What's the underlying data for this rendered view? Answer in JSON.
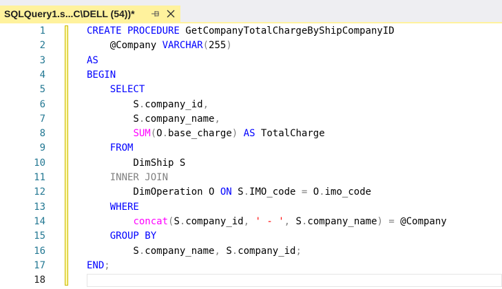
{
  "tab": {
    "title": "SQLQuery1.s...C\\DELL (54))*",
    "pin_icon": "pin-icon",
    "close_icon": "close-icon"
  },
  "colors": {
    "tab_active": "#fff29d",
    "keyword": "#0000ff",
    "operator": "#808080",
    "function": "#ff00ff",
    "string": "#ff0000",
    "line_number": "#237893"
  },
  "editor": {
    "current_line": 18,
    "lines": [
      {
        "num": "1",
        "tokens": [
          [
            "",
            "CREATE PROCEDURE",
            "kw"
          ],
          [
            " GetCompanyTotalChargeByShipCompanyID",
            "txt"
          ]
        ]
      },
      {
        "num": "2",
        "tokens": [
          [
            "    @Company ",
            "txt"
          ],
          [
            "VARCHAR",
            "kw"
          ],
          [
            "(",
            "gray"
          ],
          [
            "255",
            "txt"
          ],
          [
            ")",
            "gray"
          ]
        ]
      },
      {
        "num": "3",
        "tokens": [
          [
            "AS",
            "kw"
          ]
        ]
      },
      {
        "num": "4",
        "tokens": [
          [
            "BEGIN",
            "kw"
          ]
        ]
      },
      {
        "num": "5",
        "tokens": [
          [
            "    ",
            "txt"
          ],
          [
            "SELECT",
            "kw"
          ]
        ]
      },
      {
        "num": "6",
        "tokens": [
          [
            "        S",
            "txt"
          ],
          [
            ".",
            "gray"
          ],
          [
            "company_id",
            "txt"
          ],
          [
            ",",
            "gray"
          ]
        ]
      },
      {
        "num": "7",
        "tokens": [
          [
            "        S",
            "txt"
          ],
          [
            ".",
            "gray"
          ],
          [
            "company_name",
            "txt"
          ],
          [
            ",",
            "gray"
          ]
        ]
      },
      {
        "num": "8",
        "tokens": [
          [
            "        ",
            "txt"
          ],
          [
            "SUM",
            "fn"
          ],
          [
            "(",
            "gray"
          ],
          [
            "O",
            "txt"
          ],
          [
            ".",
            "gray"
          ],
          [
            "base_charge",
            "txt"
          ],
          [
            ")",
            "gray"
          ],
          [
            " ",
            "txt"
          ],
          [
            "AS",
            "kw"
          ],
          [
            " TotalCharge",
            "txt"
          ]
        ]
      },
      {
        "num": "9",
        "tokens": [
          [
            "    ",
            "txt"
          ],
          [
            "FROM",
            "kw"
          ]
        ]
      },
      {
        "num": "10",
        "tokens": [
          [
            "        DimShip S",
            "txt"
          ]
        ]
      },
      {
        "num": "11",
        "tokens": [
          [
            "    ",
            "txt"
          ],
          [
            "INNER JOIN",
            "gray"
          ]
        ]
      },
      {
        "num": "12",
        "tokens": [
          [
            "        DimOperation O ",
            "txt"
          ],
          [
            "ON",
            "kw"
          ],
          [
            " S",
            "txt"
          ],
          [
            ".",
            "gray"
          ],
          [
            "IMO_code ",
            "txt"
          ],
          [
            "=",
            "gray"
          ],
          [
            " O",
            "txt"
          ],
          [
            ".",
            "gray"
          ],
          [
            "imo_code",
            "txt"
          ]
        ]
      },
      {
        "num": "13",
        "tokens": [
          [
            "    ",
            "txt"
          ],
          [
            "WHERE",
            "kw"
          ]
        ]
      },
      {
        "num": "14",
        "tokens": [
          [
            "        ",
            "txt"
          ],
          [
            "concat",
            "fn"
          ],
          [
            "(",
            "gray"
          ],
          [
            "S",
            "txt"
          ],
          [
            ".",
            "gray"
          ],
          [
            "company_id",
            "txt"
          ],
          [
            ",",
            "gray"
          ],
          [
            " ",
            "txt"
          ],
          [
            "' - '",
            "str"
          ],
          [
            ",",
            "gray"
          ],
          [
            " S",
            "txt"
          ],
          [
            ".",
            "gray"
          ],
          [
            "company_name",
            "txt"
          ],
          [
            ")",
            "gray"
          ],
          [
            " ",
            "txt"
          ],
          [
            "=",
            "gray"
          ],
          [
            " @Company",
            "txt"
          ]
        ]
      },
      {
        "num": "15",
        "tokens": [
          [
            "    ",
            "txt"
          ],
          [
            "GROUP BY",
            "kw"
          ]
        ]
      },
      {
        "num": "16",
        "tokens": [
          [
            "        S",
            "txt"
          ],
          [
            ".",
            "gray"
          ],
          [
            "company_name",
            "txt"
          ],
          [
            ",",
            "gray"
          ],
          [
            " S",
            "txt"
          ],
          [
            ".",
            "gray"
          ],
          [
            "company_id",
            "txt"
          ],
          [
            ";",
            "gray"
          ]
        ]
      },
      {
        "num": "17",
        "tokens": [
          [
            "END",
            "kw"
          ],
          [
            ";",
            "gray"
          ]
        ]
      },
      {
        "num": "18",
        "tokens": []
      }
    ]
  }
}
